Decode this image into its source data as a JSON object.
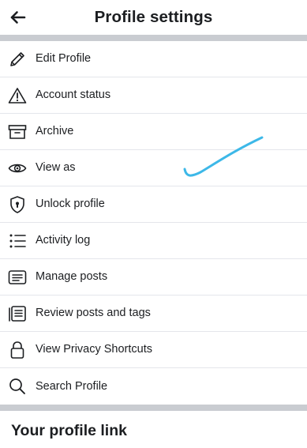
{
  "header": {
    "title": "Profile settings"
  },
  "menu": {
    "items": [
      {
        "label": "Edit Profile",
        "icon": "pencil-icon"
      },
      {
        "label": "Account status",
        "icon": "warning-icon"
      },
      {
        "label": "Archive",
        "icon": "archive-box-icon"
      },
      {
        "label": "View as",
        "icon": "eye-icon"
      },
      {
        "label": "Unlock profile",
        "icon": "lock-shield-icon"
      },
      {
        "label": "Activity log",
        "icon": "list-icon"
      },
      {
        "label": "Manage posts",
        "icon": "manage-posts-icon"
      },
      {
        "label": "Review posts and tags",
        "icon": "review-posts-icon"
      },
      {
        "label": "View Privacy Shortcuts",
        "icon": "padlock-icon"
      },
      {
        "label": "Search Profile",
        "icon": "search-icon"
      }
    ]
  },
  "profile_link": {
    "title": "Your profile link"
  },
  "colors": {
    "divider": "#c9ccd1",
    "text": "#1c1e21",
    "scribble": "#3db8e8"
  }
}
